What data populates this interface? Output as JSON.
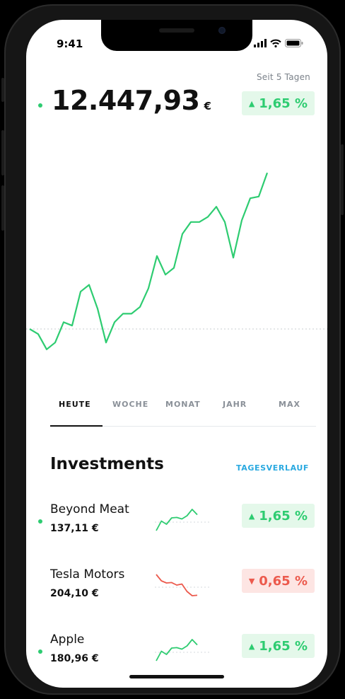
{
  "status": {
    "time": "9:41"
  },
  "portfolio": {
    "period_label": "Seit 5 Tagen",
    "value": "12.447,93",
    "currency": "€",
    "change": "1,65 %",
    "change_direction": "up"
  },
  "chart_data": {
    "type": "line",
    "color": "#2ecc71",
    "baseline_style": "dotted",
    "points": [
      0.0,
      -0.03,
      -0.12,
      -0.08,
      0.04,
      0.02,
      0.22,
      0.26,
      0.12,
      -0.08,
      0.04,
      0.09,
      0.09,
      0.13,
      0.24,
      0.43,
      0.32,
      0.36,
      0.56,
      0.63,
      0.63,
      0.66,
      0.72,
      0.63,
      0.42,
      0.64,
      0.77,
      0.78,
      0.92
    ]
  },
  "tabs": [
    {
      "label": "HEUTE",
      "active": true
    },
    {
      "label": "WOCHE",
      "active": false
    },
    {
      "label": "MONAT",
      "active": false
    },
    {
      "label": "JAHR",
      "active": false
    },
    {
      "label": "MAX",
      "active": false
    }
  ],
  "investments": {
    "title": "Investments",
    "link": "TAGESVERLAUF",
    "items": [
      {
        "name": "Beyond Meat",
        "price": "137,11 €",
        "change": "1,65 %",
        "direction": "up",
        "dot": true,
        "spark": [
          0.0,
          0.45,
          0.3,
          0.6,
          0.62,
          0.55,
          0.7,
          1.0,
          0.75
        ]
      },
      {
        "name": "Tesla Motors",
        "price": "204,10 €",
        "change": "0,65 %",
        "direction": "down",
        "dot": false,
        "spark": [
          1.0,
          0.7,
          0.6,
          0.62,
          0.5,
          0.55,
          0.2,
          0.0,
          0.02
        ]
      },
      {
        "name": "Apple",
        "price": "180,96 €",
        "change": "1,65 %",
        "direction": "up",
        "dot": true,
        "spark": [
          0.0,
          0.45,
          0.3,
          0.6,
          0.62,
          0.55,
          0.7,
          1.0,
          0.75
        ]
      }
    ]
  }
}
